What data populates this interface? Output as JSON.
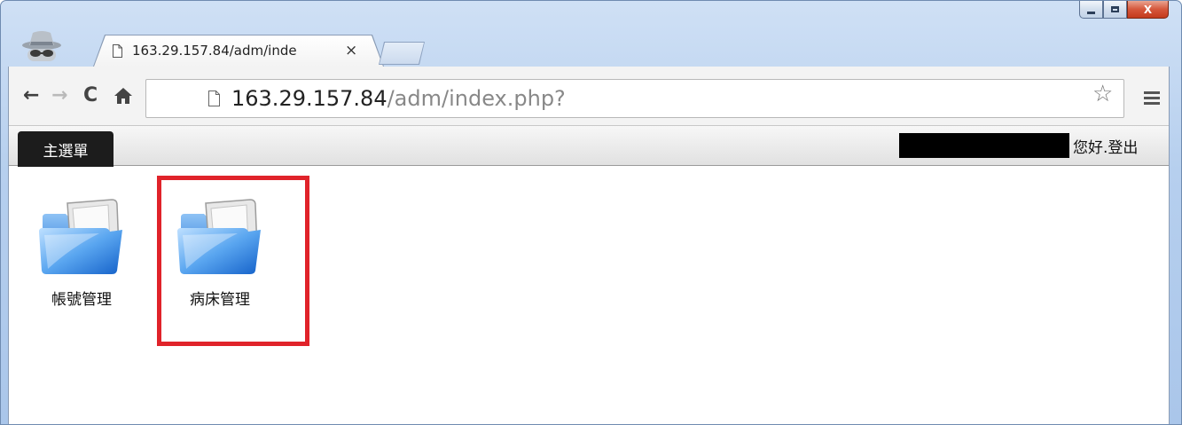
{
  "window": {
    "caption_buttons": {
      "minimize_icon": "minimize-icon",
      "maximize_icon": "maximize-icon",
      "close_label": "X"
    }
  },
  "tabs": [
    {
      "title": "163.29.157.84/adm/inde",
      "close_label": "×"
    }
  ],
  "toolbar": {
    "back_label": "←",
    "forward_label": "→",
    "reload_label": "C",
    "home_label": "🏠",
    "url_host": "163.29.157.84",
    "url_path": "/adm/index.php?",
    "star_label": "☆"
  },
  "menubar": {
    "main_menu_label": "主選單",
    "greeting": "您好.登出"
  },
  "folders": [
    {
      "label": "帳號管理"
    },
    {
      "label": "病床管理"
    }
  ],
  "colors": {
    "highlight": "#e0232a",
    "menu_button_bg": "#1c1c1c"
  }
}
